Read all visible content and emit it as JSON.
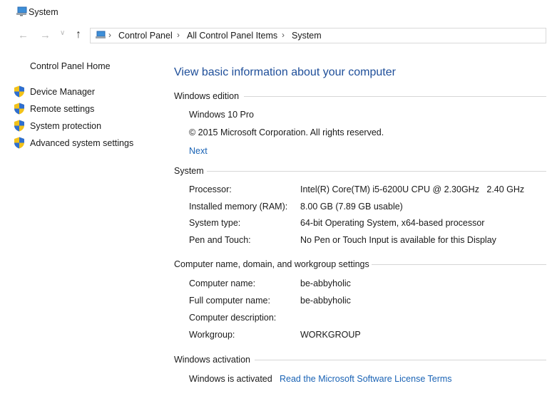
{
  "window": {
    "title": "System",
    "icon": "system-icon"
  },
  "address_bar": {
    "icon": "control-panel-icon",
    "crumbs": [
      "Control Panel",
      "All Control Panel Items",
      "System"
    ]
  },
  "sidebar": {
    "home": "Control Panel Home",
    "items": [
      {
        "label": "Device Manager",
        "icon": "uac-shield-icon"
      },
      {
        "label": "Remote settings",
        "icon": "uac-shield-icon"
      },
      {
        "label": "System protection",
        "icon": "uac-shield-icon"
      },
      {
        "label": "Advanced system settings",
        "icon": "uac-shield-icon"
      }
    ]
  },
  "main": {
    "title": "View basic information about your computer",
    "edition": {
      "heading": "Windows edition",
      "name": "Windows 10 Pro",
      "copyright": "© 2015 Microsoft Corporation. All rights reserved.",
      "next_link": "Next"
    },
    "system": {
      "heading": "System",
      "rows": [
        {
          "label": "Processor:",
          "value": "Intel(R) Core(TM) i5-6200U CPU @ 2.30GHz   2.40 GHz"
        },
        {
          "label": "Installed memory (RAM):",
          "value": "8.00 GB (7.89 GB usable)"
        },
        {
          "label": "System type:",
          "value": "64-bit Operating System, x64-based processor"
        },
        {
          "label": "Pen and Touch:",
          "value": "No Pen or Touch Input is available for this Display"
        }
      ]
    },
    "computer": {
      "heading": "Computer name, domain, and workgroup settings",
      "rows": [
        {
          "label": "Computer name:",
          "value": "be-abbyholic"
        },
        {
          "label": "Full computer name:",
          "value": "be-abbyholic"
        },
        {
          "label": "Computer description:",
          "value": ""
        },
        {
          "label": "Workgroup:",
          "value": "WORKGROUP"
        }
      ]
    },
    "activation": {
      "heading": "Windows activation",
      "status": "Windows is activated",
      "license_link": "Read the Microsoft Software License Terms"
    }
  },
  "colors": {
    "title_blue": "#1e4e99",
    "link_blue": "#1a63b5",
    "rule": "#d6d6d6"
  }
}
